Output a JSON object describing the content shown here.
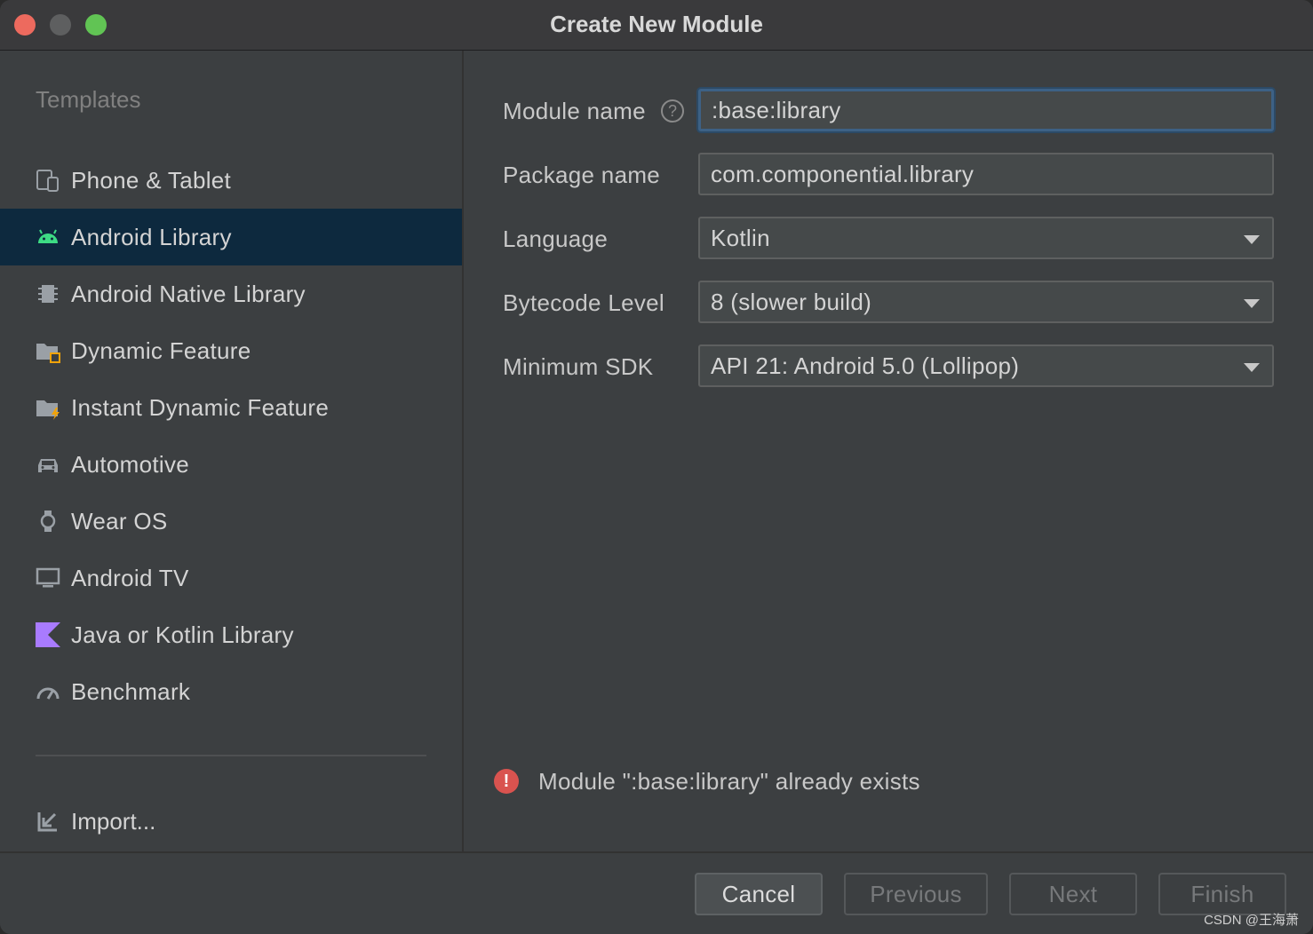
{
  "window": {
    "title": "Create New Module"
  },
  "sidebar": {
    "heading": "Templates",
    "items": [
      {
        "label": "Phone & Tablet",
        "icon": "phone-tablet-icon",
        "selected": false
      },
      {
        "label": "Android Library",
        "icon": "android-icon",
        "selected": true
      },
      {
        "label": "Android Native Library",
        "icon": "native-chip-icon",
        "selected": false
      },
      {
        "label": "Dynamic Feature",
        "icon": "dynamic-feature-folder-icon",
        "selected": false
      },
      {
        "label": "Instant Dynamic Feature",
        "icon": "instant-feature-folder-icon",
        "selected": false
      },
      {
        "label": "Automotive",
        "icon": "car-icon",
        "selected": false
      },
      {
        "label": "Wear OS",
        "icon": "watch-icon",
        "selected": false
      },
      {
        "label": "Android TV",
        "icon": "tv-icon",
        "selected": false
      },
      {
        "label": "Java or Kotlin Library",
        "icon": "kotlin-icon",
        "selected": false
      },
      {
        "label": "Benchmark",
        "icon": "gauge-icon",
        "selected": false
      }
    ],
    "import_label": "Import..."
  },
  "form": {
    "module_name": {
      "label": "Module name",
      "value": ":base:library"
    },
    "package_name": {
      "label": "Package name",
      "value": "com.componential.library"
    },
    "language": {
      "label": "Language",
      "value": "Kotlin"
    },
    "bytecode_level": {
      "label": "Bytecode Level",
      "value": "8 (slower build)"
    },
    "minimum_sdk": {
      "label": "Minimum SDK",
      "value": "API 21: Android 5.0 (Lollipop)"
    }
  },
  "error": {
    "message": "Module \":base:library\" already exists"
  },
  "footer": {
    "cancel_label": "Cancel",
    "previous_label": "Previous",
    "next_label": "Next",
    "finish_label": "Finish"
  },
  "watermark": "CSDN @王海萧",
  "colors": {
    "selected_row": "#0d293e",
    "focus_border": "#3d6185",
    "error": "#d9534f",
    "android_green": "#3ddc84",
    "kotlin_purple": "#a97bff"
  }
}
